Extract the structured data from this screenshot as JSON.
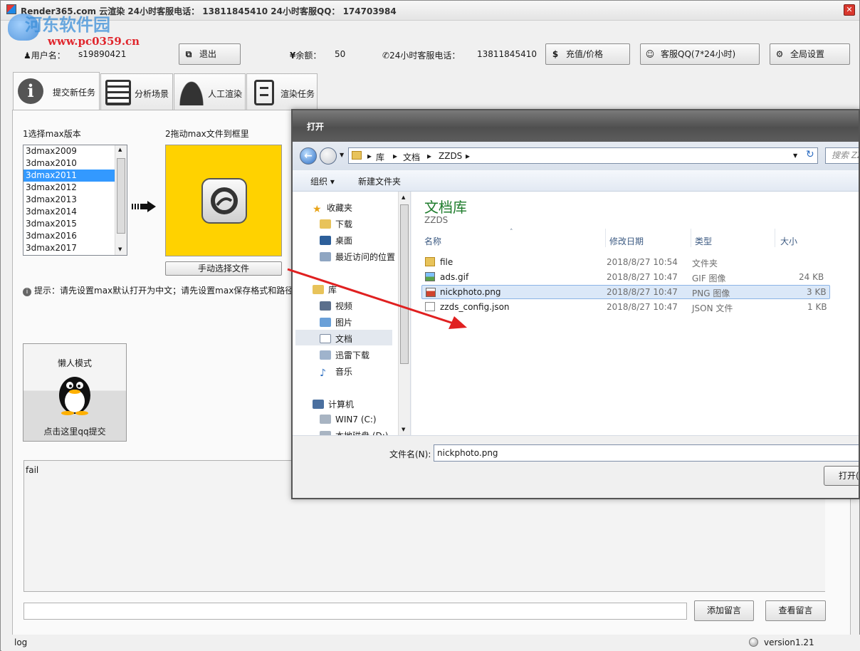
{
  "window": {
    "title": "Render365.com 云渲染  24小时客服电话：  13811845410   24小时客服QQ：  174703984",
    "close_glyph": "✕",
    "watermark_cn": "河东软件园",
    "watermark_url": "www.pc0359.cn"
  },
  "header": {
    "username_label": "用户名：",
    "username": "s19890421",
    "logout_label": "退出",
    "balance_label": "余额：",
    "balance": "50",
    "hotline_label": "24小时客服电话：",
    "hotline": "13811845410",
    "recharge_label": "充值/价格",
    "qq_label": "客服QQ(7*24小时)",
    "settings_label": "全局设置"
  },
  "tabs": [
    {
      "label": "提交新任务",
      "icon": "info-icon"
    },
    {
      "label": "分析场景",
      "icon": "server-icon"
    },
    {
      "label": "人工渲染",
      "icon": "headset-icon"
    },
    {
      "label": "渲染任务",
      "icon": "document-icon"
    }
  ],
  "main": {
    "step1_label": "1选择max版本",
    "step2_label": "2拖动max文件到框里",
    "versions": [
      "3dmax2009",
      "3dmax2010",
      "3dmax2011",
      "3dmax2012",
      "3dmax2013",
      "3dmax2014",
      "3dmax2015",
      "3dmax2016",
      "3dmax2017"
    ],
    "selected_version": "3dmax2011",
    "manual_select_label": "手动选择文件",
    "tip": "提示：请先设置max默认打开为中文；请先设置max保存格式和路径",
    "lazy_mode_label": "懒人模式",
    "lazy_submit_label": "点击这里qq提交",
    "log_text": "fail",
    "add_message_label": "添加留言",
    "view_message_label": "查看留言"
  },
  "status": {
    "left": "log",
    "version": "version1.21"
  },
  "dialog": {
    "title": "打开",
    "breadcrumb": [
      "库",
      "文档",
      "ZZDS"
    ],
    "search_placeholder": "搜索 ZZ",
    "organize_label": "组织 ▾",
    "new_folder_label": "新建文件夹",
    "nav": {
      "favorites": "收藏夹",
      "downloads": "下载",
      "desktop": "桌面",
      "recent": "最近访问的位置",
      "libraries": "库",
      "videos": "视频",
      "pictures": "图片",
      "documents": "文档",
      "xunlei": "迅雷下载",
      "music": "音乐",
      "computer": "计算机",
      "drive_c": "WIN7 (C:)",
      "drive_d": "本地磁盘 (D:)"
    },
    "library_title": "文档库",
    "library_subtitle": "ZZDS",
    "columns": {
      "name": "名称",
      "date": "修改日期",
      "type": "类型",
      "size": "大小"
    },
    "files": [
      {
        "name": "file",
        "date": "2018/8/27 10:54",
        "type": "文件夹",
        "size": "",
        "icon": "folder-icon"
      },
      {
        "name": "ads.gif",
        "date": "2018/8/27 10:47",
        "type": "GIF 图像",
        "size": "24 KB",
        "icon": "image-icon"
      },
      {
        "name": "nickphoto.png",
        "date": "2018/8/27 10:47",
        "type": "PNG 图像",
        "size": "3 KB",
        "icon": "image-icon"
      },
      {
        "name": "zzds_config.json",
        "date": "2018/8/27 10:47",
        "type": "JSON 文件",
        "size": "1 KB",
        "icon": "file-icon"
      }
    ],
    "selected_file": "nickphoto.png",
    "filename_label": "文件名(N):",
    "filename_value": "nickphoto.png",
    "open_label": "打开("
  },
  "colors": {
    "dropzone": "#ffd200",
    "selection": "#3399ff",
    "library_title": "#1e7c2c",
    "arrow": "#e02020"
  }
}
